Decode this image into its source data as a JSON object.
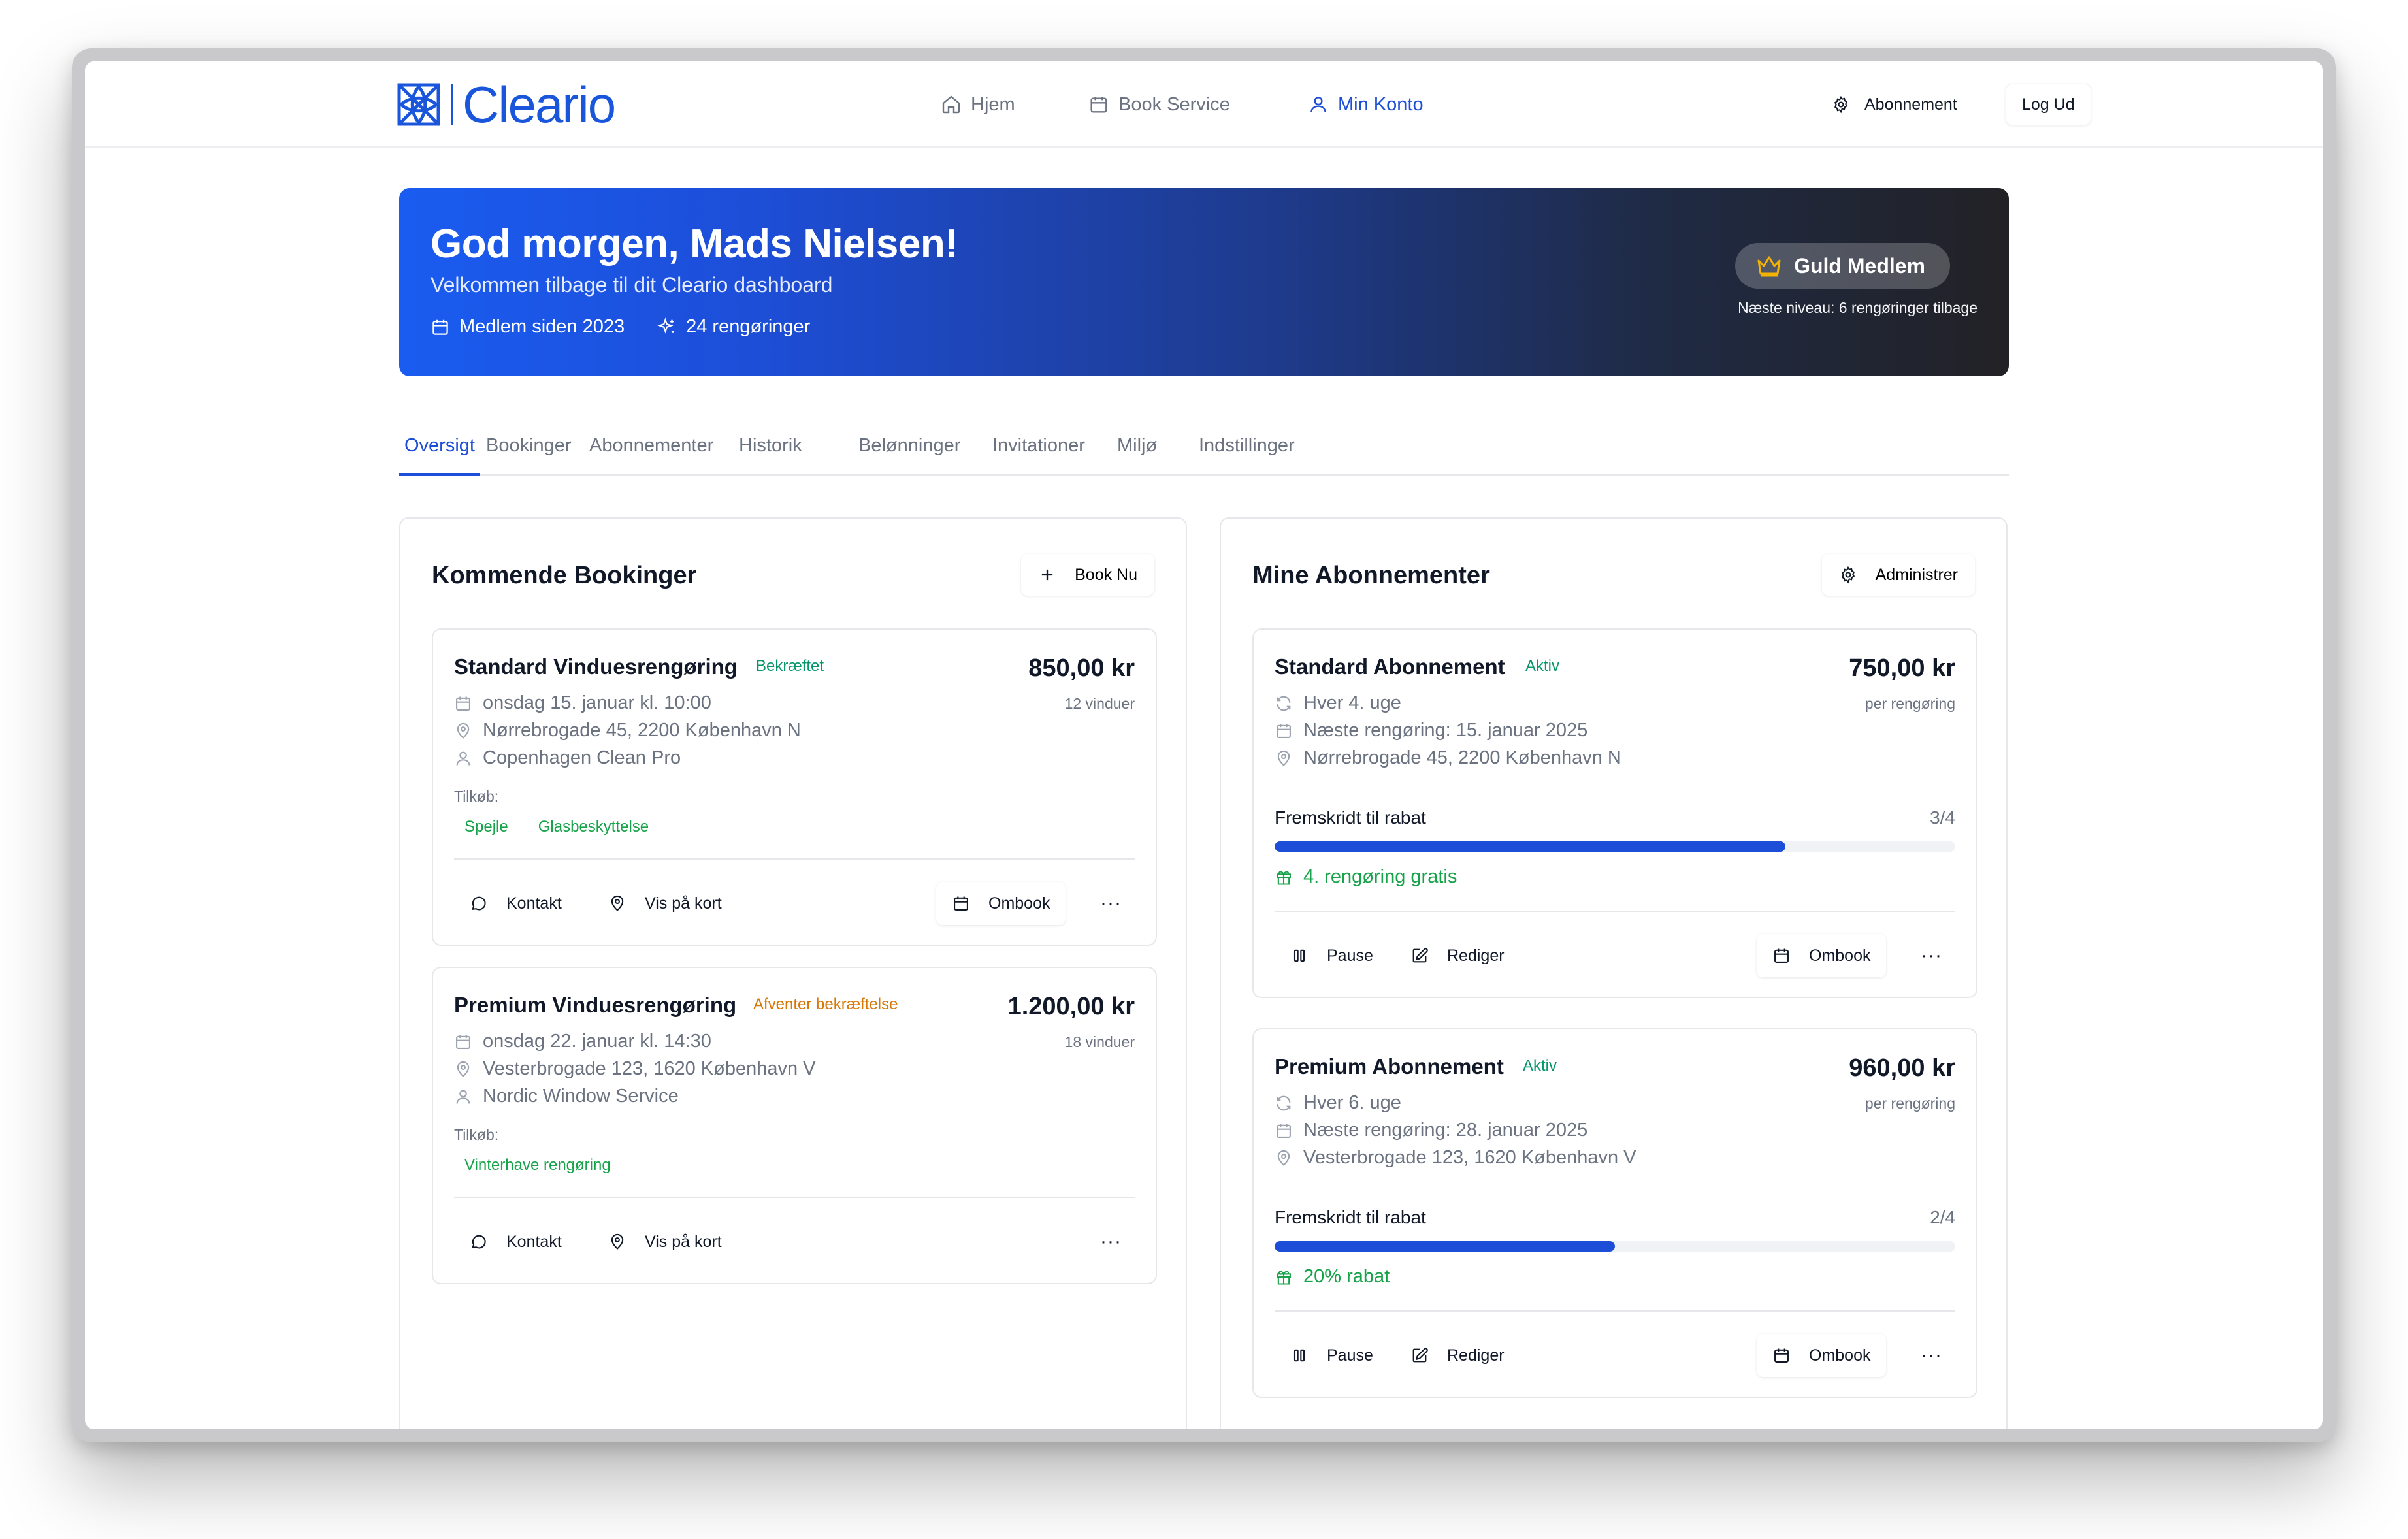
{
  "nav": {
    "logo_text": "Cleario",
    "links": [
      {
        "label": "Hjem",
        "icon": "home-icon",
        "active": false
      },
      {
        "label": "Book Service",
        "icon": "calendar-icon",
        "active": false
      },
      {
        "label": "Min Konto",
        "icon": "user-icon",
        "active": true
      }
    ],
    "subscription_label": "Abonnement",
    "logout_label": "Log Ud"
  },
  "hero": {
    "greeting": "God morgen, Mads Nielsen!",
    "subtitle": "Velkommen tilbage til dit Cleario dashboard",
    "member_since": "Medlem siden 2023",
    "cleanings": "24 rengøringer",
    "tier_badge": "Guld Medlem",
    "next_level": "Næste niveau: 6 rengøringer tilbage"
  },
  "tabs": [
    "Oversigt",
    "Bookinger",
    "Abonnementer",
    "Historik",
    "Belønninger",
    "Invitationer",
    "Miljø",
    "Indstillinger"
  ],
  "bookings": {
    "title": "Kommende Bookinger",
    "action_label": "Book Nu",
    "items": [
      {
        "title": "Standard Vinduesrengøring",
        "status": "Bekræftet",
        "price": "850,00 kr",
        "price_sub": "12 vinduer",
        "date": "onsdag 15. januar kl. 10:00",
        "address": "Nørrebrogade 45, 2200 København N",
        "provider": "Copenhagen Clean Pro",
        "addons_label": "Tilkøb:",
        "addons": [
          "Spejle",
          "Glasbeskyttelse"
        ],
        "contact_label": "Kontakt",
        "map_label": "Vis på kort",
        "rebook_label": "Ombook",
        "more_label": "···"
      },
      {
        "title": "Premium Vinduesrengøring",
        "status": "Afventer bekræftelse",
        "price": "1.200,00 kr",
        "price_sub": "18 vinduer",
        "date": "onsdag 22. januar kl. 14:30",
        "address": "Vesterbrogade 123, 1620 København V",
        "provider": "Nordic Window Service",
        "addons_label": "Tilkøb:",
        "addons": [
          "Vinterhave rengøring"
        ],
        "contact_label": "Kontakt",
        "map_label": "Vis på kort",
        "more_label": "···"
      }
    ]
  },
  "subscriptions": {
    "title": "Mine Abonnementer",
    "action_label": "Administrer",
    "items": [
      {
        "title": "Standard Abonnement",
        "status": "Aktiv",
        "price": "750,00 kr",
        "price_sub": "per rengøring",
        "frequency": "Hver 4. uge",
        "next_cleaning": "Næste rengøring: 15. januar 2025",
        "address": "Nørrebrogade 45, 2200 København N",
        "progress_label": "Fremskridt til rabat",
        "progress_text": "3/4",
        "progress_fraction": 0.75,
        "reward": "4. rengøring gratis",
        "pause_label": "Pause",
        "edit_label": "Rediger",
        "rebook_label": "Ombook",
        "more_label": "···"
      },
      {
        "title": "Premium Abonnement",
        "status": "Aktiv",
        "price": "960,00 kr",
        "price_sub": "per rengøring",
        "frequency": "Hver 6. uge",
        "next_cleaning": "Næste rengøring: 28. januar 2025",
        "address": "Vesterbrogade 123, 1620 København V",
        "progress_label": "Fremskridt til rabat",
        "progress_text": "2/4",
        "progress_fraction": 0.5,
        "reward": "20% rabat",
        "pause_label": "Pause",
        "edit_label": "Rediger",
        "rebook_label": "Ombook",
        "more_label": "···"
      }
    ]
  },
  "colors": {
    "primary": "#1d4ed8",
    "success": "#16a34a",
    "warning": "#d97706",
    "gold": "#f5b301"
  }
}
